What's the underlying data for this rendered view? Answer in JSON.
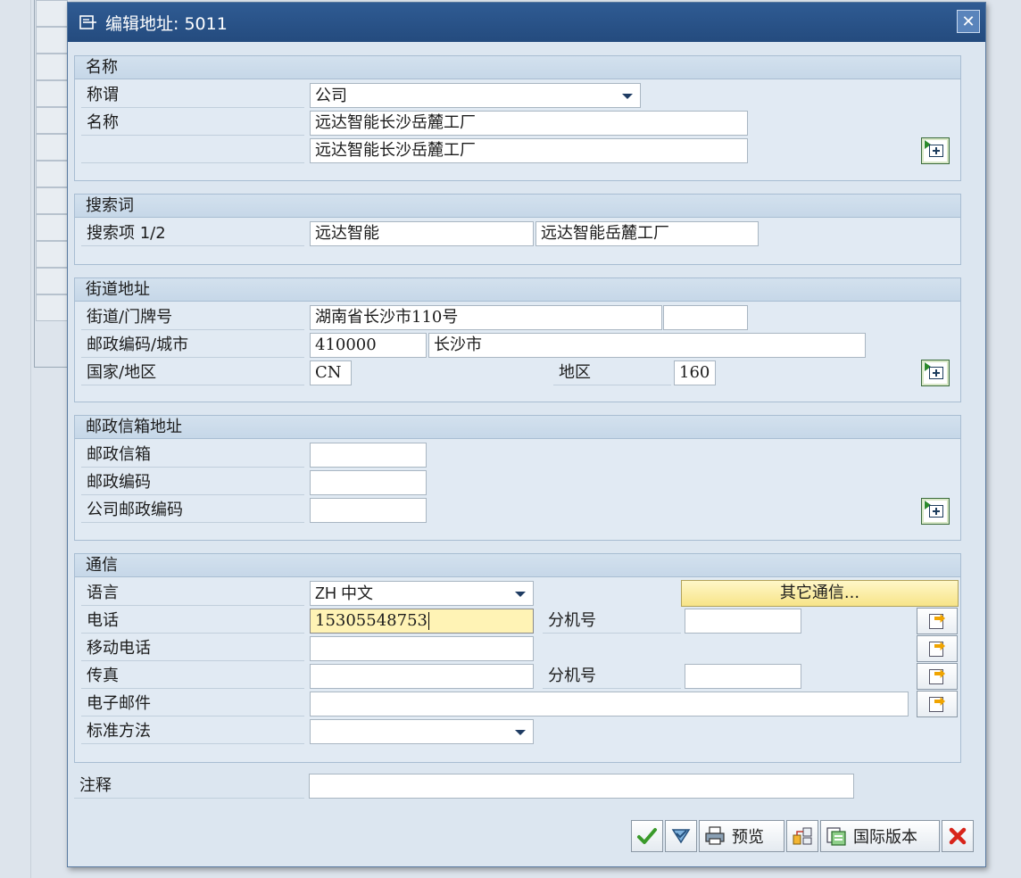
{
  "dialog": {
    "title": "编辑地址: 5011"
  },
  "name_group": {
    "header": "名称",
    "salutation_label": "称谓",
    "salutation_value": "公司",
    "name_label": "名称",
    "name1": "远达智能长沙岳麓工厂",
    "name2": "远达智能长沙岳麓工厂"
  },
  "search_group": {
    "header": "搜索词",
    "label": "搜索项 1/2",
    "term1": "远达智能",
    "term2": "远达智能岳麓工厂"
  },
  "street_group": {
    "header": "街道地址",
    "street_label": "街道/门牌号",
    "street": "湖南省长沙市110号",
    "house_no": "",
    "postal_city_label": "邮政编码/城市",
    "postal_code": "410000",
    "city": "长沙市",
    "country_label": "国家/地区",
    "country": "CN",
    "region_label": "地区",
    "region": "160"
  },
  "pobox_group": {
    "header": "邮政信箱地址",
    "pobox_label": "邮政信箱",
    "pobox_postal_label": "邮政编码",
    "company_postal_label": "公司邮政编码",
    "pobox": "",
    "pobox_postal": "",
    "company_postal": ""
  },
  "comm_group": {
    "header": "通信",
    "language_label": "语言",
    "language_value": "ZH 中文",
    "other_comm_button": "其它通信...",
    "phone_label": "电话",
    "phone": "15305548753",
    "ext_label": "分机号",
    "phone_ext": "",
    "mobile_label": "移动电话",
    "mobile": "",
    "fax_label": "传真",
    "fax": "",
    "fax_ext_label": "分机号",
    "fax_ext": "",
    "email_label": "电子邮件",
    "email": "",
    "std_method_label": "标准方法",
    "std_method": ""
  },
  "note": {
    "label": "注释",
    "value": ""
  },
  "toolbar": {
    "preview_label": "预览",
    "intl_label": "国际版本"
  },
  "colors": {
    "titlebar": "#2f5b93",
    "focus_field": "#fff3b5",
    "confirm_check": "#3a9a2a",
    "cancel_x": "#d8241a"
  }
}
